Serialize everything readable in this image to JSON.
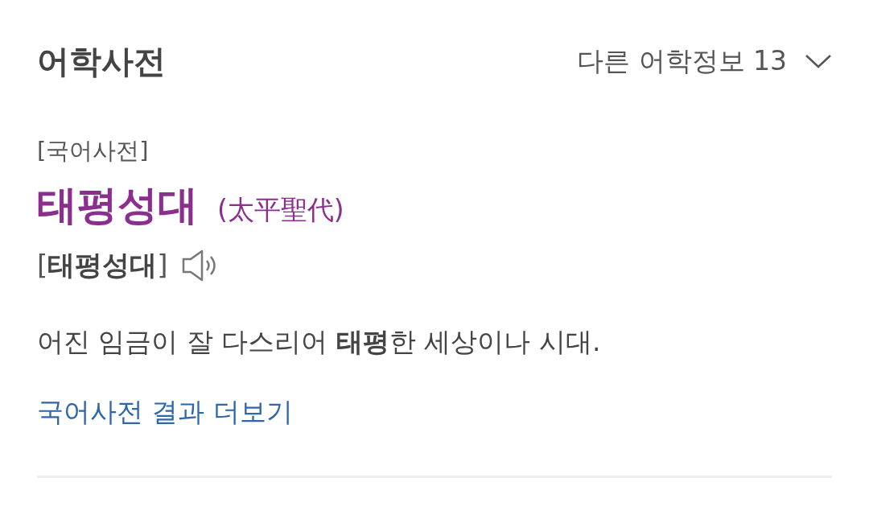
{
  "header": {
    "title": "어학사전",
    "more_info": "다른 어학정보 13"
  },
  "entry": {
    "source": "[국어사전]",
    "headword": "태평성대",
    "hanja": "(太平聖代)",
    "pronunciation": "[**태평성대**]",
    "definition": "어진 임금이 잘 다스리어 **태평**한 세상이나 시대."
  },
  "more_link": "국어사전 결과 더보기"
}
